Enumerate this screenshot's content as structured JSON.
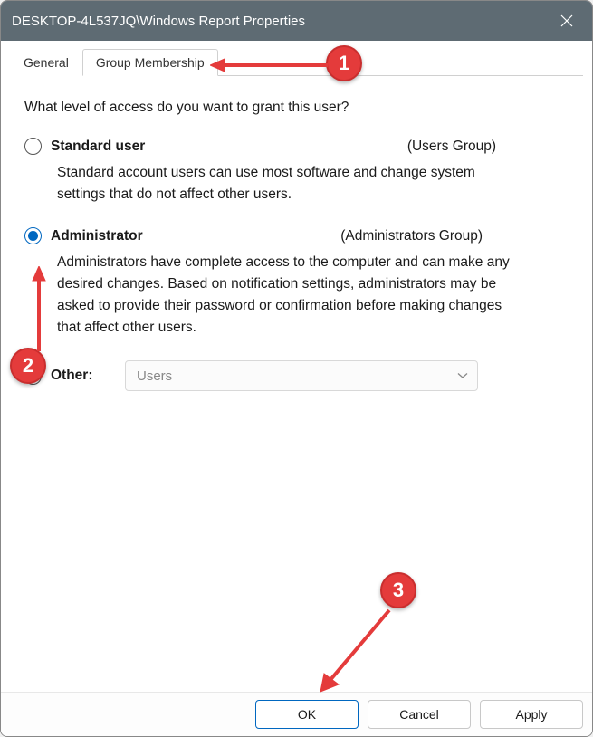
{
  "titlebar": {
    "title": "DESKTOP-4L537JQ\\Windows Report Properties"
  },
  "tabs": {
    "general": "General",
    "group_membership": "Group Membership"
  },
  "panel": {
    "question": "What level of access do you want to grant this user?",
    "standard": {
      "label": "Standard user",
      "group": "(Users Group)",
      "desc": "Standard account users can use most software and change system settings that do not affect other users."
    },
    "admin": {
      "label": "Administrator",
      "group": "(Administrators Group)",
      "desc": "Administrators have complete access to the computer and can make any desired changes. Based on notification settings, administrators may be asked to provide their password or confirmation before making changes that affect other users."
    },
    "other": {
      "label": "Other:",
      "dropdown_value": "Users"
    }
  },
  "buttons": {
    "ok": "OK",
    "cancel": "Cancel",
    "apply": "Apply"
  },
  "annotations": {
    "b1": "1",
    "b2": "2",
    "b3": "3"
  }
}
